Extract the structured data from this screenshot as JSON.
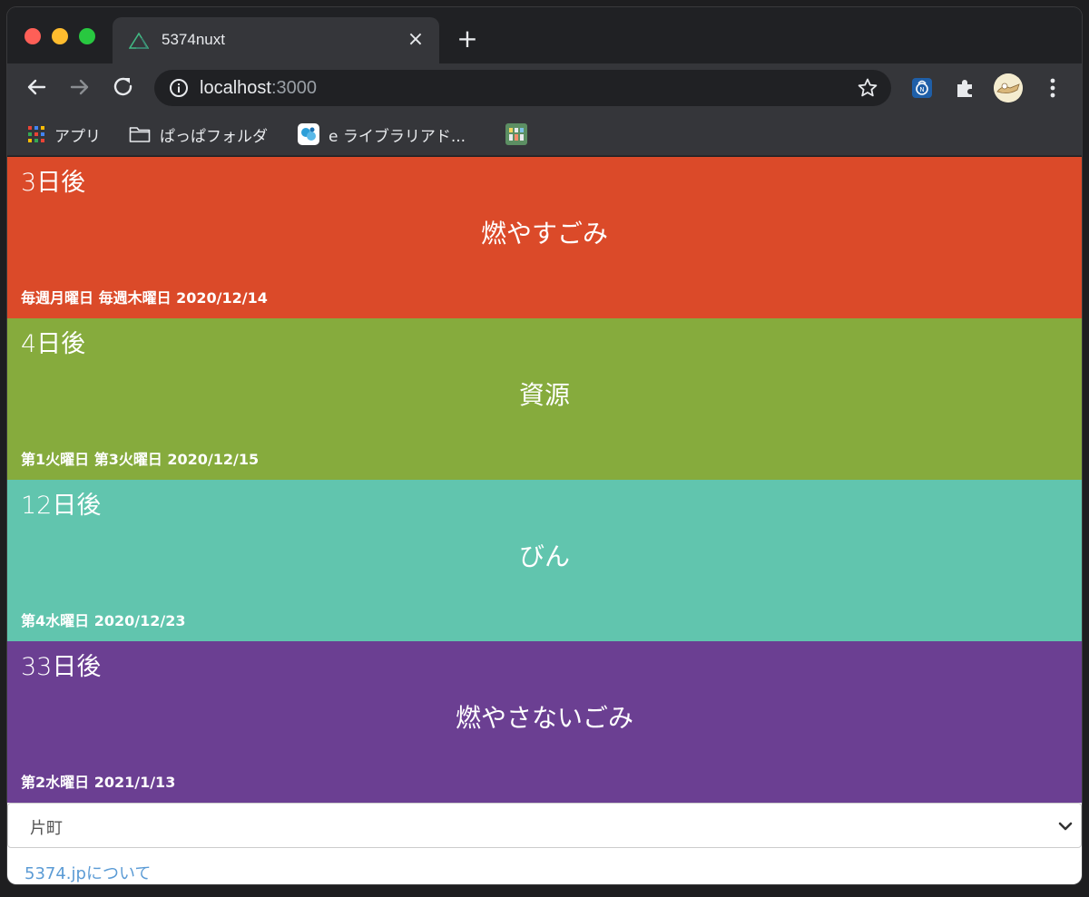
{
  "browser": {
    "tab_title": "5374nuxt",
    "tab_close_glyph": "×",
    "new_tab_glyph": "+",
    "url_host": "localhost",
    "url_port": ":3000",
    "bookmarks": [
      {
        "label": "アプリ",
        "icon": "apps-grid-icon"
      },
      {
        "label": "ぱっぱフォルダ",
        "icon": "folder-icon"
      },
      {
        "label": "e ライブラリアド...",
        "icon": "elibrary-icon"
      },
      {
        "label": "",
        "icon": "bookmark-app-icon"
      }
    ]
  },
  "cards": [
    {
      "days": "3日後",
      "type": "燃やすごみ",
      "info": "毎週月曜日 毎週木曜日 2020/12/14",
      "color": "#db4a29"
    },
    {
      "days": "4日後",
      "type": "資源",
      "info": "第1火曜日 第3火曜日 2020/12/15",
      "color": "#86ab3d"
    },
    {
      "days": "12日後",
      "type": "びん",
      "info": "第4水曜日 2020/12/23",
      "color": "#61c5ae"
    },
    {
      "days": "33日後",
      "type": "燃やさないごみ",
      "info": "第2水曜日 2021/1/13",
      "color": "#6b3f92"
    }
  ],
  "area_select": {
    "value": "片町"
  },
  "footer": {
    "about_link": "5374.jpについて"
  },
  "colors": {
    "chrome_dark": "#202124",
    "chrome_toolbar": "#35363a",
    "link": "#5b9bd5"
  }
}
